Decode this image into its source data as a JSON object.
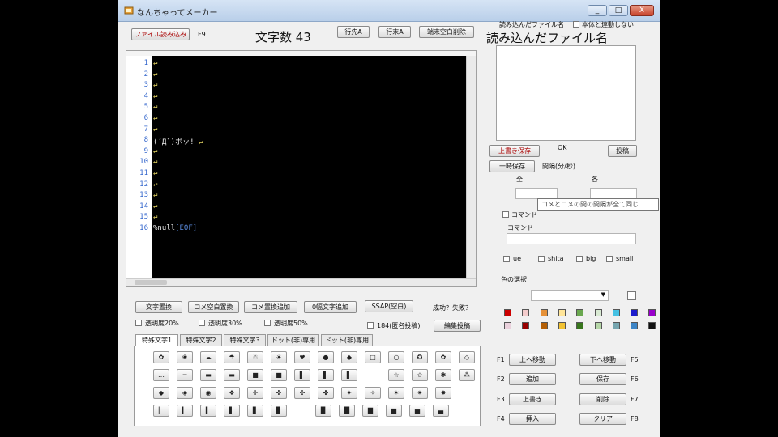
{
  "window": {
    "title": "なんちゃってメーカー",
    "controls": [
      "_",
      "□",
      "X"
    ]
  },
  "toolbar": {
    "load_button": "ファイル読み込み",
    "load_key": "F9",
    "char_count": "文字数 43",
    "line_head_button": "行先A",
    "line_end_button": "行末A",
    "trim_button": "端末空白削除"
  },
  "right_panel": {
    "file_label_small": "読み込んだファイル名",
    "file_label_large": "読み込んだファイル名",
    "sync_checkbox": "本体と連動しない",
    "overwrite_button": "上書き保存",
    "ok_text": "OK",
    "post_button": "投稿",
    "temp_save_button": "一時保存",
    "interval_label": "間隔(分/秒)",
    "all_label": "全",
    "each_label": "各",
    "tooltip": "コメとコメの間の間隔が全て同じ",
    "command_checkbox": "コマンド",
    "command_label": "コマンド",
    "command_value": "",
    "options": [
      "ue",
      "shita",
      "big",
      "small"
    ],
    "color_label": "色の選択",
    "color_selected": ""
  },
  "editor": {
    "line_numbers": [
      "1",
      "2",
      "3",
      "4",
      "5",
      "6",
      "7",
      "8",
      "9",
      "10",
      "11",
      "12",
      "13",
      "14",
      "15",
      "16"
    ],
    "lines": [
      {
        "text": "",
        "eol": "↵"
      },
      {
        "text": "",
        "eol": "↵"
      },
      {
        "text": "",
        "eol": "↵"
      },
      {
        "text": "",
        "eol": "↵"
      },
      {
        "text": "",
        "eol": "↵"
      },
      {
        "text": "",
        "eol": "↵"
      },
      {
        "text": "",
        "eol": "↵"
      },
      {
        "text": "(´Д`)ボッ! ",
        "eol": "↵"
      },
      {
        "text": "",
        "eol": "↵"
      },
      {
        "text": "",
        "eol": "↵"
      },
      {
        "text": "",
        "eol": "↵"
      },
      {
        "text": "",
        "eol": "↵"
      },
      {
        "text": "",
        "eol": "↵"
      },
      {
        "text": "",
        "eol": "↵"
      },
      {
        "text": "",
        "eol": "↵"
      },
      {
        "text": "%null",
        "eol": "[EOF]"
      }
    ]
  },
  "bottom_buttons": {
    "b1": "文字置換",
    "b2": "コメ空白置換",
    "b3": "コメ置換追加",
    "b4": "0幅文字追加",
    "b5": "SSAP(空白)",
    "result": "成功？失敗？",
    "edit_post": "編集投稿",
    "opacity20": "透明度20%",
    "opacity30": "透明度30%",
    "opacity50": "透明度50%",
    "anon184": "184(匿名投稿)"
  },
  "symbol_tabs": [
    "特殊文字1",
    "特殊文字2",
    "特殊文字3",
    "ドット(非)専用",
    "ドット(非)専用"
  ],
  "symbols": {
    "row1": [
      "✿",
      "❀",
      "☁",
      "☂",
      "☃",
      "☀",
      "❤",
      "●",
      "◆",
      "□",
      "○",
      "✪",
      "✿",
      "◇"
    ],
    "row2": [
      "…",
      "━",
      "▬",
      "▬",
      "■",
      "■",
      "▌",
      "▌",
      "▌",
      "☆",
      "✩",
      "✱",
      "⁂"
    ],
    "row3": [
      "◆",
      "◈",
      "◉",
      "❖",
      "✛",
      "✜",
      "✣",
      "✤",
      "✦",
      "✧",
      "✶",
      "✷",
      "✸"
    ],
    "row4": [
      "▏",
      "▎",
      "▍",
      "▌",
      "▋",
      "▊",
      "▉",
      "█",
      "▇",
      "▆",
      "▅",
      "▄"
    ]
  },
  "colors": {
    "row1": [
      "#cc0000",
      "#f4cccc",
      "#e69138",
      "#ffe599",
      "#6aa84f",
      "#d9ead3",
      "#45c1e3",
      "#1c1ccc",
      "#9900cc"
    ],
    "row2": [
      "#ead1dc",
      "#990000",
      "#b45f06",
      "#f1c232",
      "#38761d",
      "#b6d7a8",
      "#76a5af",
      "#3d85c6",
      "#111111"
    ]
  },
  "fkeys": {
    "f1": "F1",
    "up": "上へ移動",
    "down": "下へ移動",
    "f5": "F5",
    "f2": "F2",
    "add": "追加",
    "save": "保存",
    "f6": "F6",
    "f3": "F3",
    "overwrite": "上書き",
    "delete": "削除",
    "f7": "F7",
    "f4": "F4",
    "insert": "挿入",
    "clear": "クリア",
    "f8": "F8"
  }
}
